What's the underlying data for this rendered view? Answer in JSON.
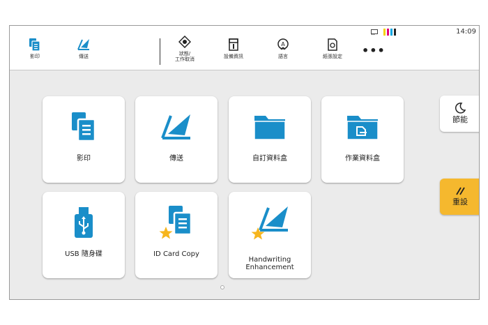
{
  "topbar": {
    "copy_label": "影印",
    "send_label": "傳送",
    "status_label_1": "狀態/",
    "status_label_2": "工作取消",
    "device_info_label": "設備資訊",
    "language_label": "語言",
    "paper_settings_label": "紙張設定",
    "more_label": "•••",
    "clock": "14:09",
    "toner_colors": [
      "#f4d000",
      "#e0007a",
      "#00a6e2",
      "#222222"
    ]
  },
  "tiles": [
    {
      "label": "影印"
    },
    {
      "label": "傳送"
    },
    {
      "label": "自訂資料盒"
    },
    {
      "label": "作業資料盒"
    },
    {
      "label": "USB 隨身碟"
    },
    {
      "label": "ID Card Copy"
    },
    {
      "label_line1": "Handwriting",
      "label_line2": "Enhancement"
    }
  ],
  "side": {
    "sleep_label": "節能",
    "reset_label": "重設"
  },
  "colors": {
    "accent_blue": "#1a8ec9",
    "star": "#f6b51d",
    "reset_bg": "#f5b82e"
  }
}
